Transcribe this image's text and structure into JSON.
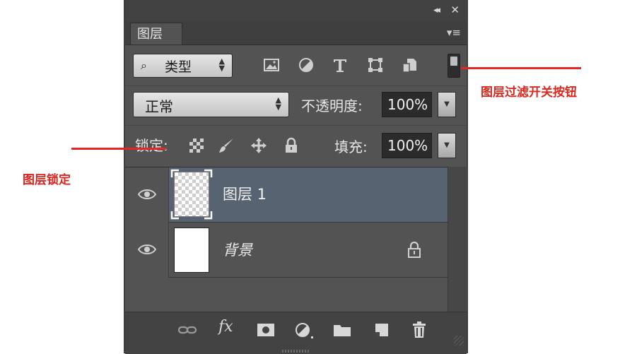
{
  "panel": {
    "tab_label": "图层",
    "collapse_glyph": "◂◂",
    "close_glyph": "✕",
    "menu_glyph": "▾≡"
  },
  "filter": {
    "search_glyph": "⌕",
    "kind_label": "类型",
    "icons": [
      "image-filter-icon",
      "adjustment-filter-icon",
      "type-filter-icon",
      "shape-filter-icon",
      "smart-object-filter-icon"
    ]
  },
  "blend": {
    "mode": "正常",
    "opacity_label": "不透明度:",
    "opacity_value": "100%",
    "lock_label": "锁定:",
    "fill_label": "填充:",
    "fill_value": "100%"
  },
  "layers": [
    {
      "name": "图层 1",
      "selected": true,
      "visible": true,
      "locked": false
    },
    {
      "name": "背景",
      "selected": false,
      "visible": true,
      "locked": true
    }
  ],
  "bottom_icons": [
    "link-layers-icon",
    "fx-icon",
    "add-mask-icon",
    "new-adjustment-icon",
    "new-group-icon",
    "new-layer-icon",
    "delete-layer-icon"
  ],
  "bottom_fx_text": "fx",
  "annotations": {
    "filter_toggle": "图层过滤开关按钮",
    "layer_lock": "图层锁定"
  },
  "colors": {
    "panel_bg": "#535353",
    "selected_row": "#586371",
    "annotation_red": "#e32626"
  }
}
